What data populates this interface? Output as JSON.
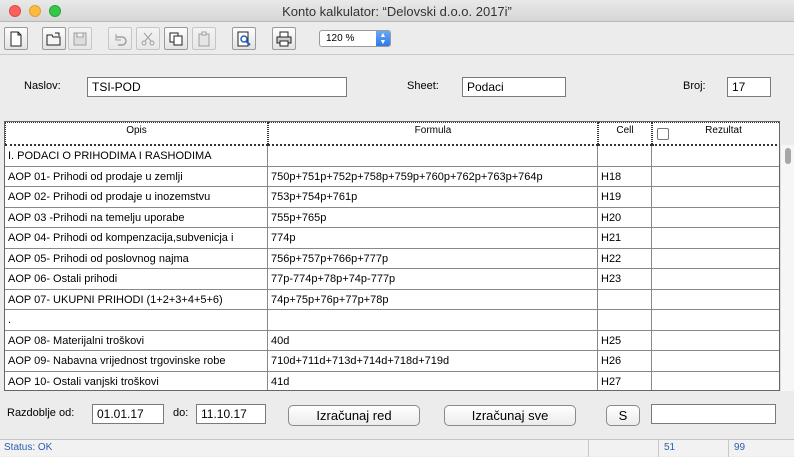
{
  "window": {
    "title": "Konto kalkulator: “Delovski d.o.o. 2017i”"
  },
  "toolbar": {
    "buttons": [
      "new-icon",
      "open-icon",
      "save-icon",
      "undo-icon",
      "cut-icon",
      "copy-icon",
      "paste-icon",
      "preview-icon",
      "print-icon"
    ],
    "zoom": "120 %"
  },
  "header": {
    "naslov_label": "Naslov:",
    "naslov_value": "TSI-POD",
    "sheet_label": "Sheet:",
    "sheet_value": "Podaci",
    "broj_label": "Broj:",
    "broj_value": "17"
  },
  "table": {
    "columns": [
      "Opis",
      "Formula",
      "Cell",
      "Rezultat"
    ],
    "rows": [
      {
        "opis": "I. PODACI O PRIHODIMA I RASHODIMA",
        "formula": "",
        "cell": "",
        "rezultat": ""
      },
      {
        "opis": "AOP 01- Prihodi od prodaje u zemlji",
        "formula": "750p+751p+752p+758p+759p+760p+762p+763p+764p",
        "cell": "H18",
        "rezultat": ""
      },
      {
        "opis": "AOP 02- Prihodi od prodaje u inozemstvu",
        "formula": "753p+754p+761p",
        "cell": "H19",
        "rezultat": ""
      },
      {
        "opis": "AOP 03 -Prihodi na temelju uporabe",
        "formula": "755p+765p",
        "cell": "H20",
        "rezultat": ""
      },
      {
        "opis": "AOP 04- Prihodi od kompenzacija,subvenicja i",
        "formula": "774p",
        "cell": "H21",
        "rezultat": ""
      },
      {
        "opis": "AOP 05- Prihodi od poslovnog najma",
        "formula": "756p+757p+766p+777p",
        "cell": "H22",
        "rezultat": ""
      },
      {
        "opis": "AOP 06- Ostali prihodi",
        "formula": "77p-774p+78p+74p-777p",
        "cell": "H23",
        "rezultat": ""
      },
      {
        "opis": "AOP 07- UKUPNI PRIHODI  (1+2+3+4+5+6)",
        "formula": "74p+75p+76p+77p+78p",
        "cell": "",
        "rezultat": ""
      },
      {
        "opis": ".",
        "formula": "",
        "cell": "",
        "rezultat": ""
      },
      {
        "opis": "AOP 08- Materijalni troškovi",
        "formula": "40d",
        "cell": "H25",
        "rezultat": ""
      },
      {
        "opis": "AOP 09- Nabavna vrijednost trgovinske robe",
        "formula": "710d+711d+713d+714d+718d+719d",
        "cell": "H26",
        "rezultat": ""
      },
      {
        "opis": "AOP 10- Ostali vanjski troškovi",
        "formula": "41d",
        "cell": "H27",
        "rezultat": ""
      }
    ]
  },
  "footer": {
    "razdoblje_label": "Razdoblje od:",
    "date_from": "01.01.17",
    "do_label": "do:",
    "date_to": "11.10.17",
    "btn_red": "Izračunaj red",
    "btn_sve": "Izračunaj sve",
    "btn_s": "S",
    "result_value": ""
  },
  "statusbar": {
    "status": "Status: OK",
    "field1": "51",
    "field2": "99"
  }
}
